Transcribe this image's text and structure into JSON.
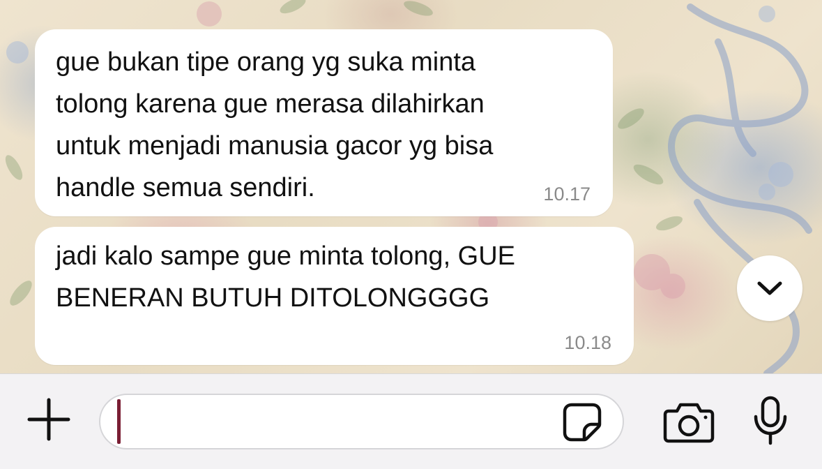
{
  "messages": [
    {
      "text": "gue bukan tipe orang yg suka minta\ntolong karena gue merasa dilahirkan\nuntuk menjadi manusia gacor yg bisa\nhandle semua sendiri.",
      "time": "10.17"
    },
    {
      "text": "jadi kalo sampe gue minta tolong, GUE\nBENERAN BUTUH DITOLONGGGG",
      "time": "10.18"
    }
  ],
  "composer": {
    "value": "",
    "placeholder": ""
  },
  "icons": {
    "attach": "plus-icon",
    "sticker": "sticker-icon",
    "camera": "camera-icon",
    "mic": "microphone-icon",
    "scroll": "chevron-down-icon"
  },
  "colors": {
    "bubble": "#ffffff",
    "caret": "#7a1e34",
    "input_bar": "#f3f2f4"
  }
}
